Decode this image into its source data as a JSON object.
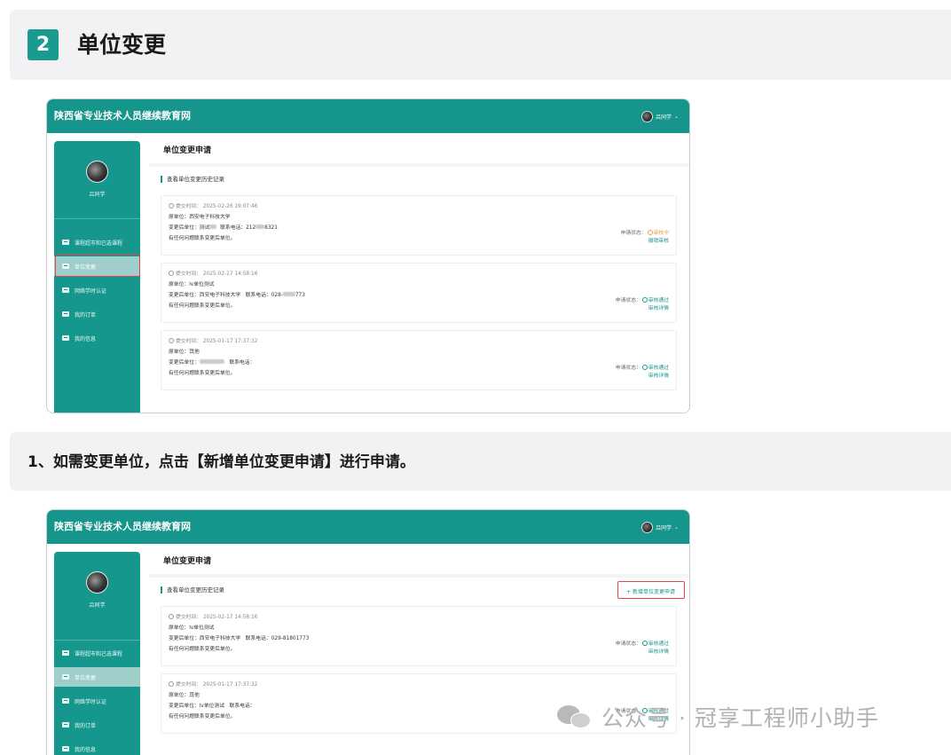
{
  "section": {
    "number": "2",
    "title": "单位变更"
  },
  "step": {
    "text": "1、如需变更单位，点击【新增单位变更申请】进行申请。"
  },
  "app": {
    "title": "陕西省专业技术人员继续教育网",
    "user_name": "吕同学",
    "menu": [
      {
        "label": "课程超市和已选课程"
      },
      {
        "label": "单位变更"
      },
      {
        "label": "网络学时认证"
      },
      {
        "label": "我的订单"
      },
      {
        "label": "我的信息"
      }
    ],
    "page_title": "单位变更申请",
    "history_title": "查看单位变更历史记录",
    "add_button": "+ 新增单位变更申请"
  },
  "screenshot1": {
    "records": [
      {
        "time": "提交时间： 2025-02-26 19:07:46",
        "orig_unit": "原单位：西安电子科技大学",
        "new_unit": "变更后单位：",
        "new_unit_partial": "测试",
        "phone_label": "联系电话：212",
        "phone_tail": "8321",
        "note": "有任何问题联系变更后单位。",
        "status_label": "申请状态：",
        "status_value": "审核中",
        "status_link": "撤销审核",
        "status_type": "pending"
      },
      {
        "time": "提交时间： 2025-02-17 14:58:16",
        "orig_unit": "原单位：lv单位测试",
        "new_unit": "变更后单位：西安电子科技大学",
        "new_unit_partial": "",
        "phone_label": "联系电话：028-",
        "phone_tail": "773",
        "note": "有任何问题联系变更后单位。",
        "status_label": "申请状态：",
        "status_value": "审核通过",
        "status_link": "审核详情",
        "status_type": "approved"
      },
      {
        "time": "提交时间： 2025-01-17 17:37:32",
        "orig_unit": "原单位：其他",
        "new_unit": "变更后单位：",
        "new_unit_partial": "",
        "phone_label": "联系电话：",
        "phone_tail": "",
        "note": "有任何问题联系变更后单位。",
        "status_label": "申请状态：",
        "status_value": "审核通过",
        "status_link": "审核详情",
        "status_type": "approved"
      }
    ]
  },
  "screenshot2": {
    "records": [
      {
        "time": "提交时间： 2025-02-17 14:58:16",
        "orig_unit": "原单位：lv单位测试",
        "new_unit": "变更后单位：西安电子科技大学",
        "phone_label": "联系电话：029-81801773",
        "note": "有任何问题联系变更后单位。",
        "status_label": "申请状态：",
        "status_value": "审核通过",
        "status_link": "审核详情"
      },
      {
        "time": "提交时间： 2025-01-17 17:37:32",
        "orig_unit": "原单位：其他",
        "new_unit": "变更后单位：lv单位测试",
        "phone_label": "联系电话：",
        "note": "有任何问题联系变更后单位。",
        "status_label": "申请状态：",
        "status_value": "审核通过",
        "status_link": "审核详情"
      }
    ]
  },
  "watermark": {
    "text": "公众号 · 冠享工程师小助手"
  },
  "colors": {
    "teal": "#15958c",
    "highlight_red": "#e0454a",
    "pending": "#e6a23c",
    "banner_bg": "#f2f2f4"
  }
}
